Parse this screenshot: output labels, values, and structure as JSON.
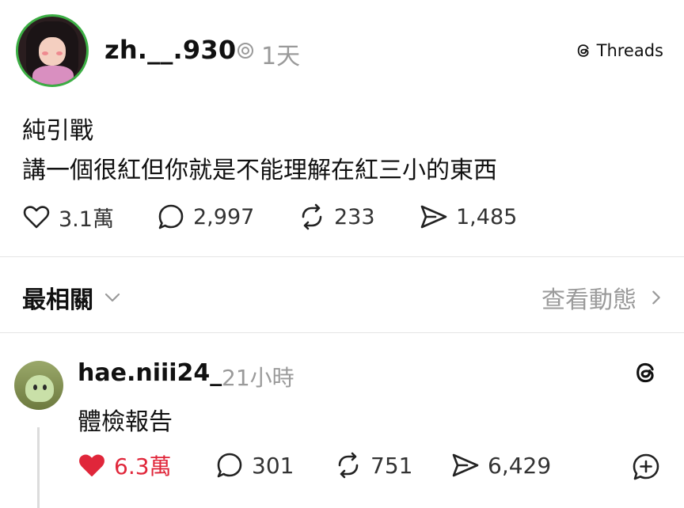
{
  "post": {
    "username": "zh.__.930",
    "time": "1天",
    "platform_badge": "Threads",
    "text_line1": "純引戰",
    "text_line2": "講一個很紅但你就是不能理解在紅三小的東西",
    "stats": {
      "likes": "3.1萬",
      "replies": "2,997",
      "reposts": "233",
      "shares": "1,485"
    }
  },
  "sort": {
    "label": "最相關",
    "activity_label": "查看動態"
  },
  "reply": {
    "username": "hae.niii24_",
    "time": "21小時",
    "text": "體檢報告",
    "liked": true,
    "stats": {
      "likes": "6.3萬",
      "replies": "301",
      "reposts": "751",
      "shares": "6,429"
    }
  },
  "colors": {
    "like_active": "#e0263a",
    "muted_text": "#9a9a9a",
    "avatar_ring": "#3cae44"
  },
  "icons": [
    "heart-icon",
    "comment-icon",
    "repost-icon",
    "share-icon",
    "threads-logo-icon",
    "chevron-down-icon",
    "chevron-right-icon",
    "add-icon"
  ]
}
